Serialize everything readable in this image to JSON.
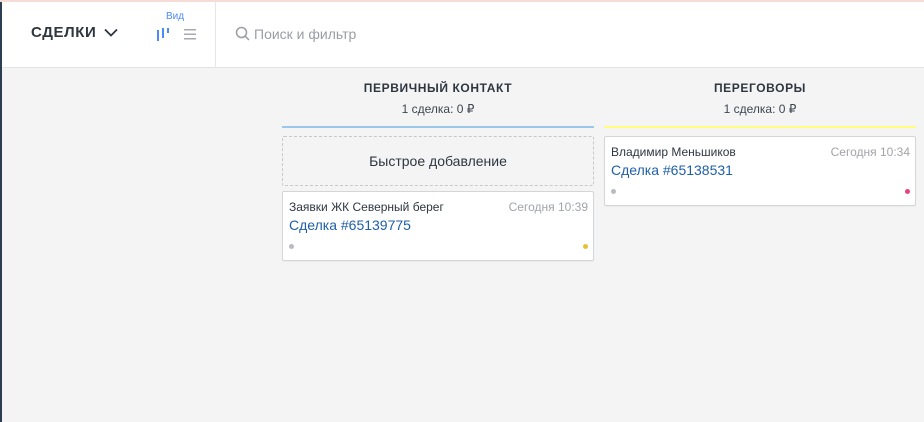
{
  "colors": {
    "accent_blue": "#4c8bf5",
    "stage_contact_line": "#99c8ea",
    "stage_negotiation_line": "#fffd7f",
    "tag_yellow": "#e6c239",
    "tag_pink": "#e8437a",
    "link": "#1f5fa8"
  },
  "header": {
    "title": "СДЕЛКИ",
    "title_icon": "chevron-down-icon",
    "view_label": "Вид",
    "view_icons": [
      "pipeline-view-icon",
      "list-view-icon"
    ],
    "search": {
      "icon": "search-icon",
      "placeholder": "Поиск и фильтр",
      "value": ""
    }
  },
  "pipeline": {
    "columns": [
      {
        "title": "ПЕРВИЧНЫЙ КОНТАКТ",
        "summary": "1 сделка: 0 ₽",
        "quick_add": "Быстрое добавление",
        "cards": [
          {
            "contact": "Заявки ЖК Северный берег",
            "time": "Сегодня 10:39",
            "deal": "Сделка #65139775",
            "tag_color": "#e6c239"
          }
        ]
      },
      {
        "title": "ПЕРЕГОВОРЫ",
        "summary": "1 сделка: 0 ₽",
        "cards": [
          {
            "contact": "Владимир Меньшиков",
            "time": "Сегодня 10:34",
            "deal": "Сделка #65138531",
            "tag_color": "#e8437a"
          }
        ]
      }
    ]
  }
}
